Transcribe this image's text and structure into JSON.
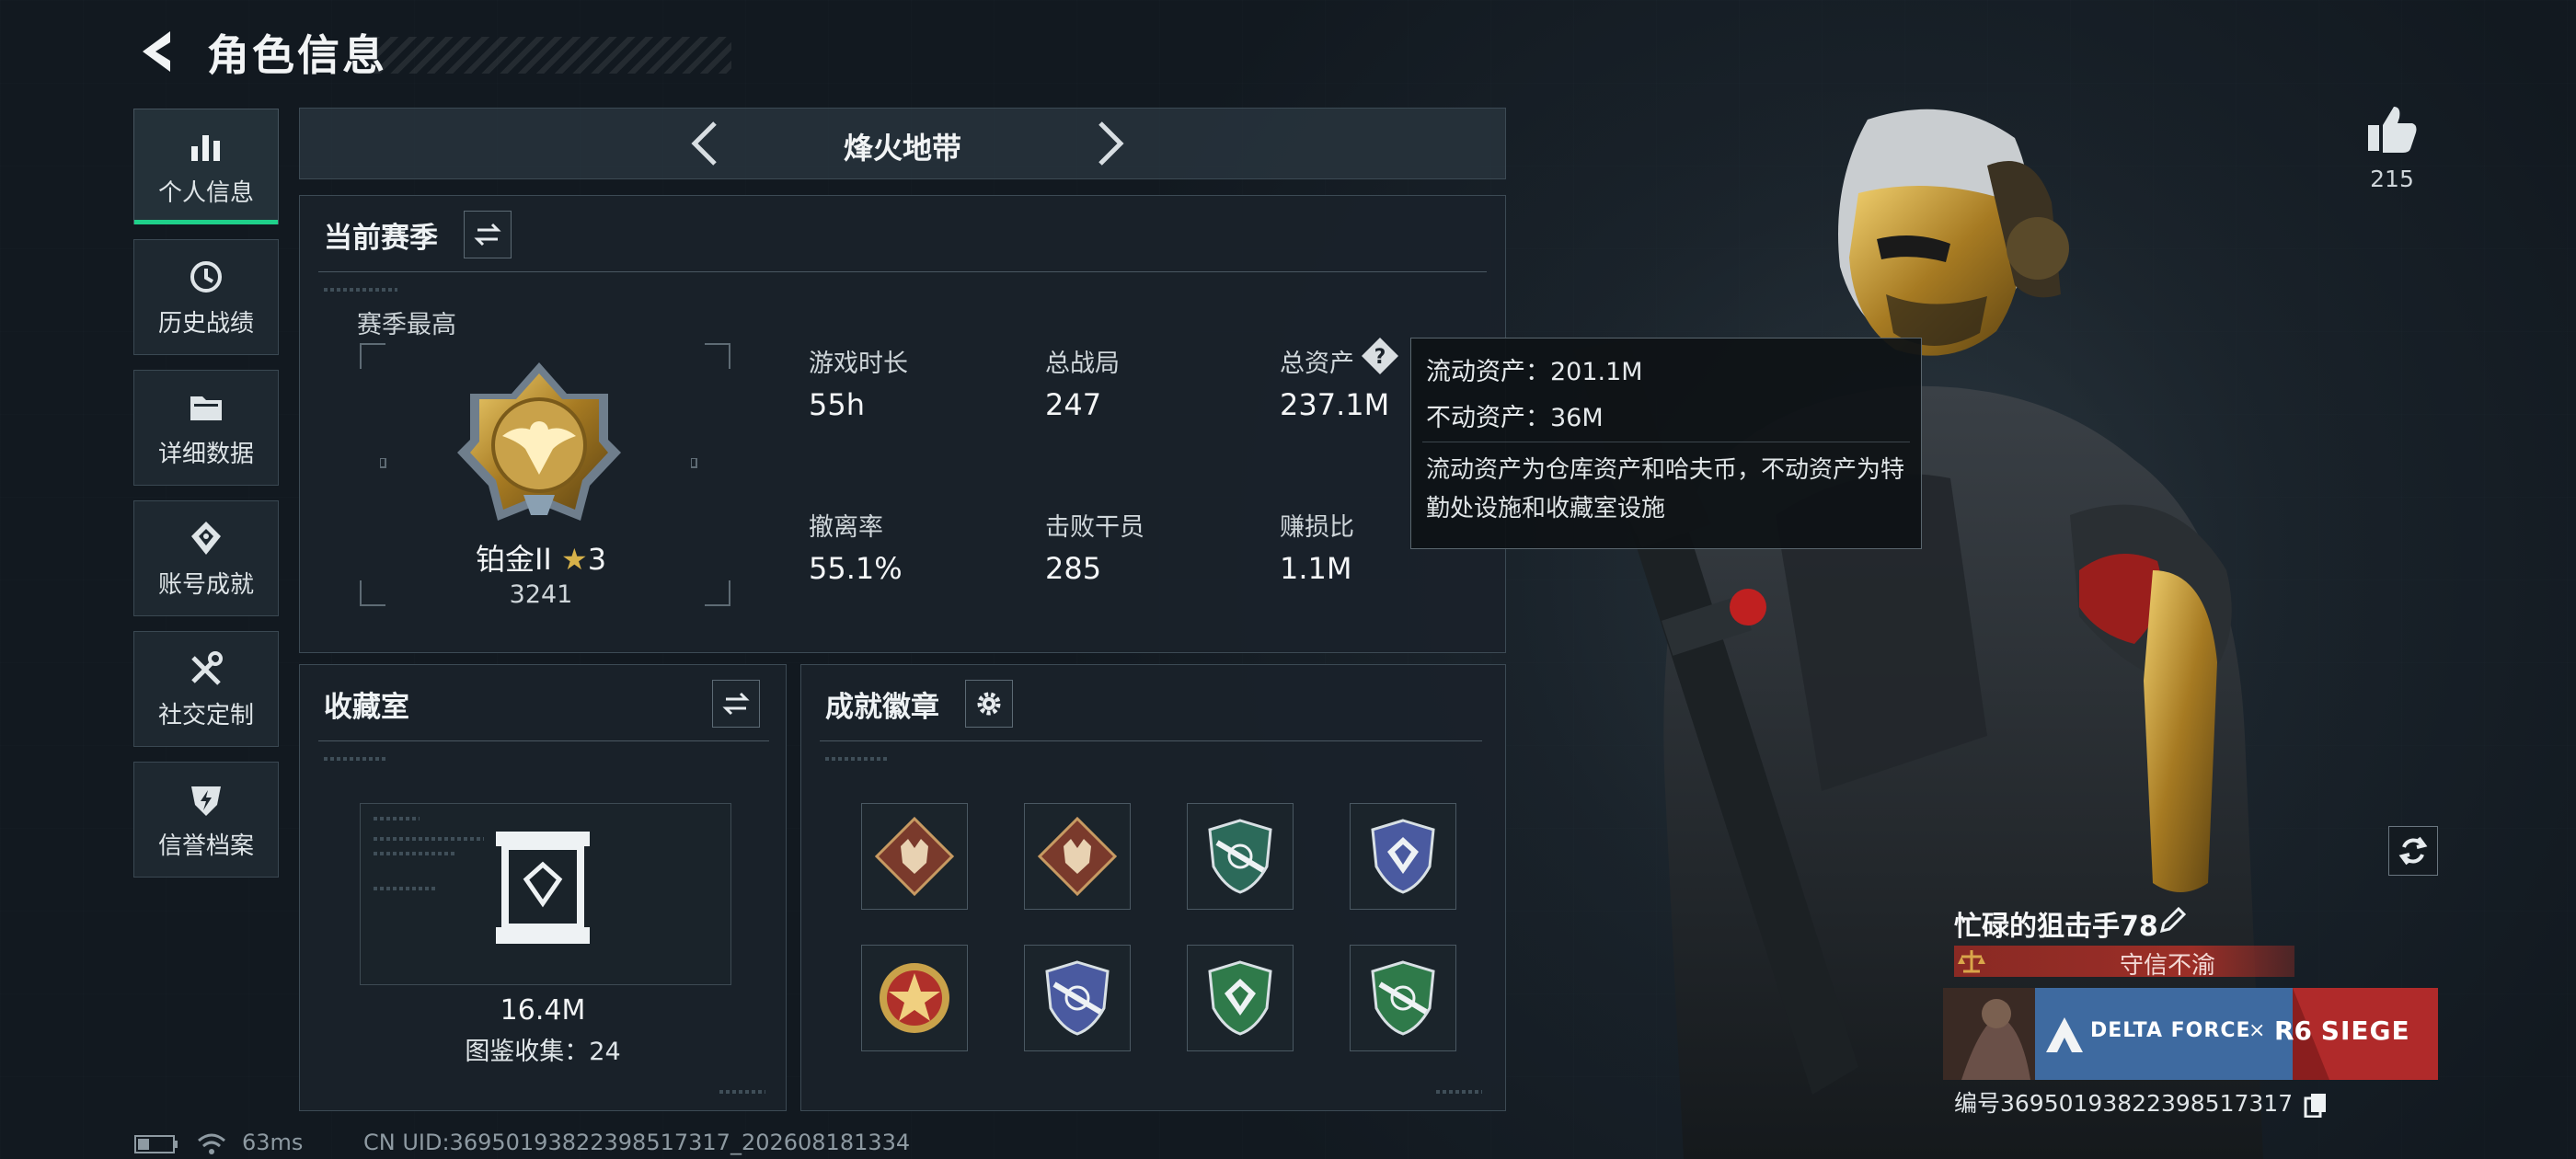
{
  "header": {
    "title": "角色信息"
  },
  "sidebar": {
    "items": [
      {
        "label": "个人信息",
        "active": true
      },
      {
        "label": "历史战绩"
      },
      {
        "label": "详细数据"
      },
      {
        "label": "账号成就"
      },
      {
        "label": "社交定制"
      },
      {
        "label": "信誉档案"
      }
    ]
  },
  "mode_switcher": {
    "current": "烽火地带"
  },
  "season": {
    "title": "当前赛季",
    "best_label": "赛季最高",
    "rank_name": "铂金II",
    "rank_stars": "3",
    "rank_score": "3241",
    "stats": [
      {
        "label": "游戏时长",
        "value": "55h"
      },
      {
        "label": "总战局",
        "value": "247"
      },
      {
        "label": "总资产",
        "value": "237.1M"
      },
      {
        "label": "撤离率",
        "value": "55.1%"
      },
      {
        "label": "击败干员",
        "value": "285"
      },
      {
        "label": "赚损比",
        "value": "1.1M"
      }
    ]
  },
  "asset_tooltip": {
    "liquid": "流动资产：201.1M",
    "fixed": "不动资产：36M",
    "description": "流动资产为仓库资产和哈夫币，不动资产为特勤处设施和收藏室设施"
  },
  "collection": {
    "title": "收藏室",
    "value": "16.4M",
    "count_text": "图鉴收集：24"
  },
  "achievements": {
    "title": "成就徽章",
    "badges": [
      {
        "icon": "wolf-badge-icon",
        "color": "#7a3a2c"
      },
      {
        "icon": "wolf-badge-icon",
        "color": "#7a3a2c"
      },
      {
        "icon": "rifle-shield-badge-icon",
        "color": "#2c6a5a"
      },
      {
        "icon": "shield-badge-icon",
        "color": "#4a5aa0"
      },
      {
        "icon": "star-badge-icon",
        "color": "#b0302a"
      },
      {
        "icon": "rifle-shield-badge-icon",
        "color": "#4a5aa0"
      },
      {
        "icon": "shield-badge-icon",
        "color": "#2f7a4a"
      },
      {
        "icon": "rifle-shield-badge-icon",
        "color": "#2f7a4a"
      }
    ]
  },
  "likes": {
    "count": "215"
  },
  "player": {
    "name": "忙碌的狙击手78",
    "reputation": "守信不渝",
    "banner_left": "DELTA FORCE",
    "banner_x": "×",
    "banner_right_a": "R6",
    "banner_right_b": "SIEGE",
    "uid": "编号3695019382239851731​7"
  },
  "status": {
    "ping": "63ms",
    "cn_uid": "CN UID:3695019382239851731​7_202608181334"
  },
  "colors": {
    "accent": "#1fd08a",
    "gold": "#c9a24a",
    "reputation_red": "#9b2e27"
  }
}
